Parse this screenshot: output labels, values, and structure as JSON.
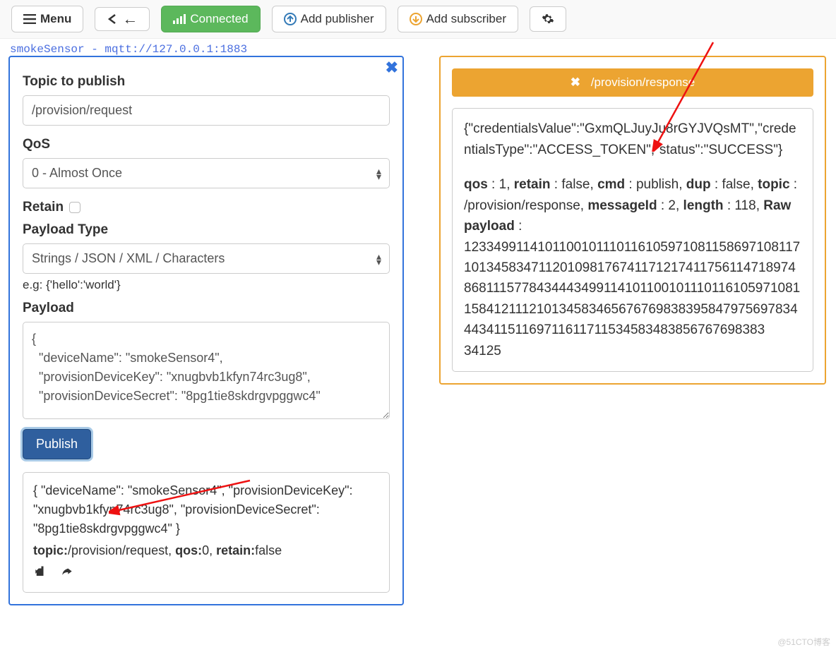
{
  "toolbar": {
    "menu": "Menu",
    "connected": "Connected",
    "add_publisher": "Add publisher",
    "add_subscriber": "Add subscriber"
  },
  "tab": "smokeSensor - mqtt://127.0.0.1:1883",
  "publisher": {
    "topic_label": "Topic to publish",
    "topic_value": "/provision/request",
    "qos_label": "QoS",
    "qos_value": "0 - Almost Once",
    "retain_label": "Retain",
    "payload_type_label": "Payload Type",
    "payload_type_value": "Strings / JSON / XML / Characters",
    "payload_type_hint": "e.g: {'hello':'world'}",
    "payload_label": "Payload",
    "payload_value": "{\n  \"deviceName\": \"smokeSensor4\",\n  \"provisionDeviceKey\": \"xnugbvb1kfyn74rc3ug8\",\n  \"provisionDeviceSecret\": \"8pg1tie8skdrgvpggwc4\"",
    "publish_button": "Publish",
    "sent_payload": "{ \"deviceName\": \"smokeSensor4\", \"provisionDeviceKey\": \"xnugbvb1kfyn74rc3ug8\", \"provisionDeviceSecret\": \"8pg1tie8skdrgvpggwc4\" }",
    "sent_topic_label": "topic:",
    "sent_topic": "/provision/request",
    "sent_qos_label": "qos:",
    "sent_qos": "0",
    "sent_retain_label": "retain:",
    "sent_retain": "false"
  },
  "subscriber": {
    "header_topic": "/provision/response",
    "message_json": "{\"credentialsValue\":\"GxmQLJuyJu8rGYJVQsMT\",\"credentialsType\":\"ACCESS_TOKEN\",\"status\":\"SUCCESS\"}",
    "meta": {
      "qos_label": "qos",
      "qos": "1",
      "retain_label": "retain",
      "retain": "false",
      "cmd_label": "cmd",
      "cmd": "publish",
      "dup_label": "dup",
      "dup": "false",
      "topic_label": "topic",
      "topic": "/provision/response",
      "messageId_label": "messageId",
      "messageId": "2",
      "length_label": "length",
      "length": "118",
      "raw_label": "Raw payload",
      "raw": "1233499114101100101110116105971081158697108117101345834711201098176741171217411756114718974868111577843444349911410110010111011610597108115841211121013458346567676983839584797569783444341151169711611711534583483856767698383​34125"
    }
  },
  "watermark": "@51CTO博客"
}
